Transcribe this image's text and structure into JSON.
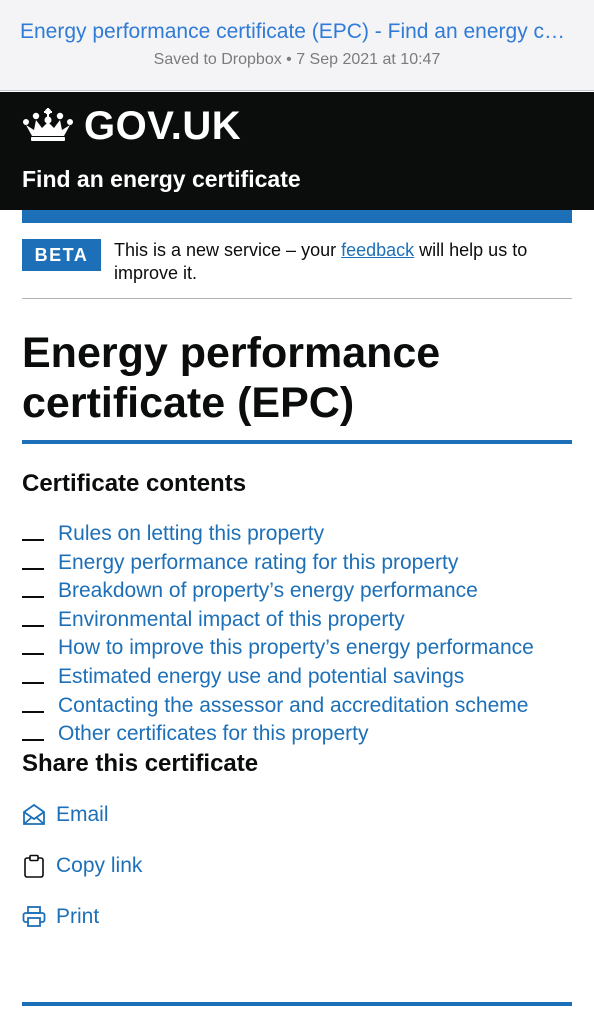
{
  "browser": {
    "title": "Energy performance certificate (EPC) - Find an energy certificate",
    "subtitle": "Saved to Dropbox • 7 Sep 2021 at 10:47"
  },
  "header": {
    "logo": "GOV.UK",
    "service_name": "Find an energy certificate"
  },
  "banner": {
    "tag": "BETA",
    "text_before": "This is a new service – your ",
    "link": "feedback",
    "text_after": " will help us to improve it."
  },
  "page": {
    "title": "Energy performance certificate (EPC)"
  },
  "contents": {
    "heading": "Certificate contents",
    "items": [
      "Rules on letting this property",
      "Energy performance rating for this property",
      "Breakdown of property’s energy performance",
      "Environmental impact of this property",
      "How to improve this property’s energy performance",
      "Estimated energy use and potential savings",
      "Contacting the assessor and accreditation scheme",
      "Other certificates for this property"
    ]
  },
  "share": {
    "heading": "Share this certificate",
    "email": "Email",
    "copy_link": "Copy link",
    "print": "Print"
  },
  "icons": {
    "crown": "crown-icon",
    "email": "envelope-icon",
    "copy": "clipboard-icon",
    "print": "printer-icon"
  },
  "colors": {
    "link": "#1d70b8",
    "header_bg": "#0b0c0c",
    "accent": "#1d70b8"
  }
}
